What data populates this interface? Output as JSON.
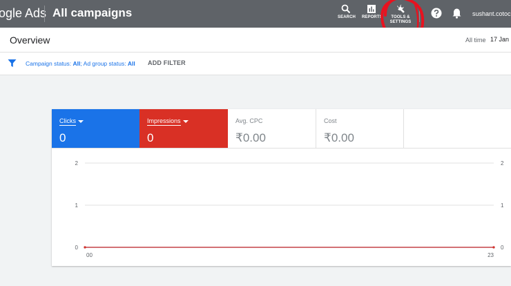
{
  "header": {
    "brand": "ogle Ads",
    "page_title": "All campaigns",
    "tools": [
      {
        "label": "SEARCH",
        "icon": "search-icon"
      },
      {
        "label": "REPORTS",
        "icon": "reports-icon"
      },
      {
        "label_line1": "TOOLS &",
        "label_line2": "SETTINGS",
        "icon": "wrench-icon"
      }
    ],
    "account": "sushant.cotocu"
  },
  "subheader": {
    "title": "Overview",
    "date_label": "All time",
    "date_value": "17 Jan"
  },
  "filters": {
    "status_label": "Campaign status: ",
    "status_value": "All",
    "sep": "; ",
    "adgroup_label": "Ad group status: ",
    "adgroup_value": "All",
    "add_filter": "ADD FILTER"
  },
  "metrics": [
    {
      "name": "Clicks",
      "value": "0",
      "color": "#1a73e8"
    },
    {
      "name": "Impressions",
      "value": "0",
      "color": "#d93025"
    },
    {
      "name": "Avg. CPC",
      "value": "₹0.00"
    },
    {
      "name": "Cost",
      "value": "₹0.00"
    }
  ],
  "colors": {
    "topbar": "#5f6368",
    "accent_blue": "#1a73e8",
    "accent_red": "#d93025",
    "annotation": "#e8121f"
  },
  "chart_data": {
    "type": "line",
    "x": [
      0,
      23
    ],
    "x_tick_labels": [
      "00",
      "23"
    ],
    "y_ticks_left": [
      "2",
      "1",
      "0"
    ],
    "y_ticks_right": [
      "2",
      "1",
      "0"
    ],
    "ylim": [
      0,
      2
    ],
    "grid": true,
    "series": [
      {
        "values": [
          0,
          0
        ],
        "color": "#1a73e8"
      },
      {
        "values": [
          0,
          0
        ],
        "color": "#d93025"
      }
    ]
  }
}
